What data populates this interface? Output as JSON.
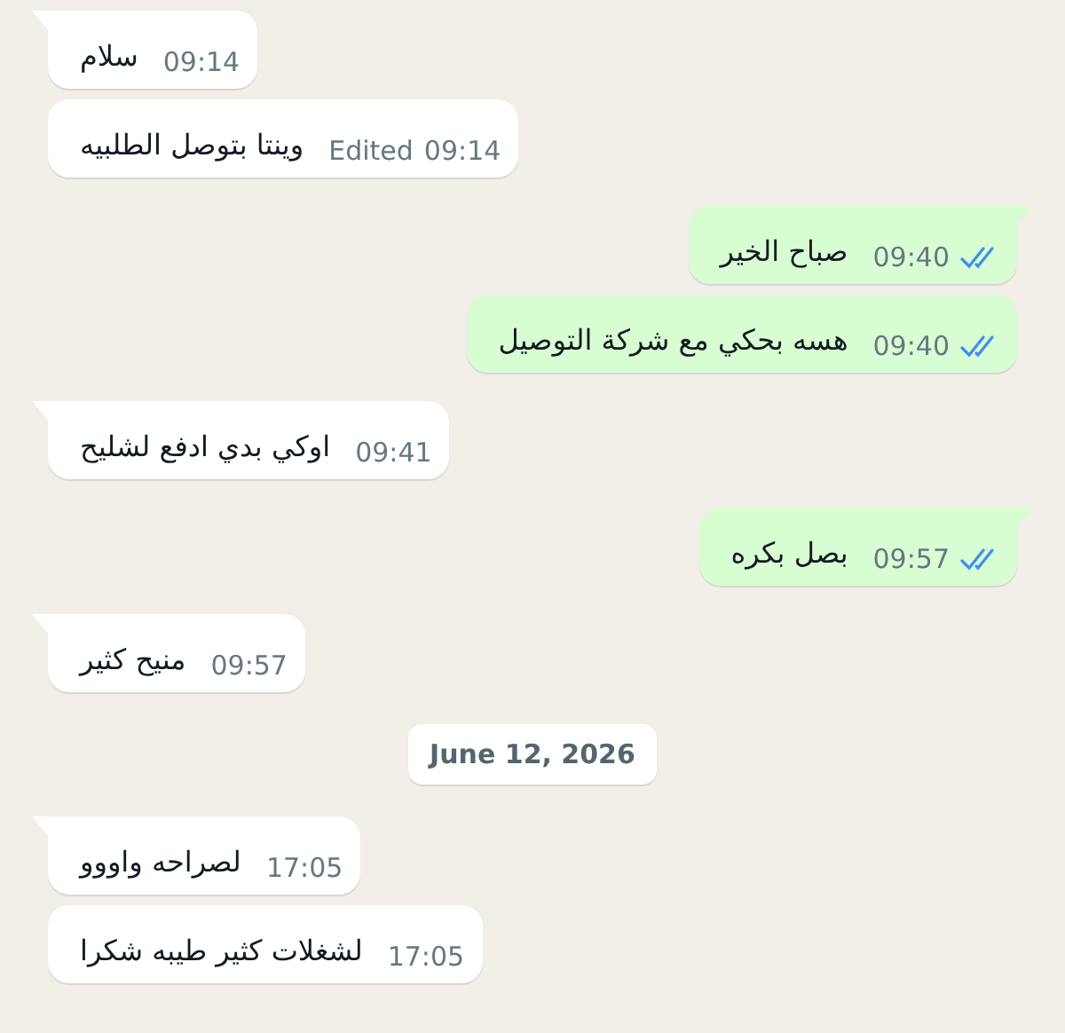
{
  "messages": [
    {
      "kind": "message",
      "outgoing": false,
      "tail": true,
      "text": "سلام",
      "time": "09:14"
    },
    {
      "kind": "message",
      "outgoing": false,
      "tail": false,
      "text": "وينتا بتوصل الطلبيه",
      "edited": "Edited",
      "time": "09:14"
    },
    {
      "kind": "message",
      "outgoing": true,
      "tail": true,
      "text": "صباح الخير",
      "time": "09:40",
      "read": true
    },
    {
      "kind": "message",
      "outgoing": true,
      "tail": false,
      "text": "هسه بحكي مع شركة التوصيل",
      "time": "09:40",
      "read": true
    },
    {
      "kind": "message",
      "outgoing": false,
      "tail": true,
      "text": "اوكي بدي ادفع لشليح",
      "time": "09:41"
    },
    {
      "kind": "message",
      "outgoing": true,
      "tail": true,
      "text": "بصل بكره",
      "time": "09:57",
      "read": true
    },
    {
      "kind": "message",
      "outgoing": false,
      "tail": true,
      "text": "منيح كثير",
      "time": "09:57"
    },
    {
      "kind": "date",
      "text": "June 12, 2026"
    },
    {
      "kind": "message",
      "outgoing": false,
      "tail": true,
      "text": "لصراحه واووو",
      "time": "17:05"
    },
    {
      "kind": "message",
      "outgoing": false,
      "tail": false,
      "text": "لشغلات كثير طيبه شكرا",
      "time": "17:05"
    }
  ]
}
